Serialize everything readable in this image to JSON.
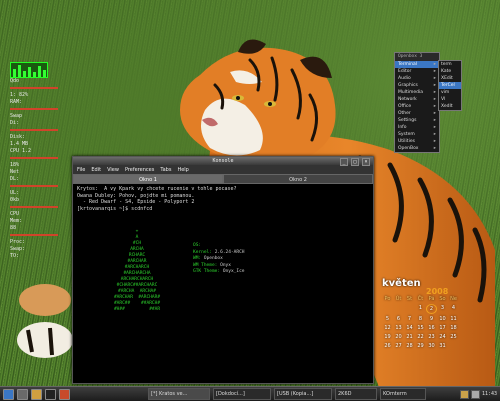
{
  "conky": {
    "lines": [
      "Qdo",
      "1: 82%",
      "RAM:",
      "",
      "Swap",
      "Di:",
      "Disk:",
      "1.4 MB",
      "CPU 1.2",
      "18%",
      "",
      "Net",
      "DL:",
      "UL:",
      "0kb",
      "CPU",
      "Mem:",
      "88",
      "Proc:",
      "Swap:",
      "TO:"
    ]
  },
  "terminal": {
    "title": "Konsole",
    "menu": [
      "File",
      "Edit",
      "View",
      "Preferences",
      "Tabs",
      "Help"
    ],
    "tabs": [
      "Okno 1",
      "Okno 2"
    ],
    "lines": [
      "Krytos:  A vy Kpark vy chcete rucenie v tohle pocase?",
      "",
      "Owana Dubley: Pohov, pojdte mi pomanou.",
      "  - Red Dwarf - S4, Epside - Polyport 2",
      "[krtovanarqis ~]$ scdnfcd"
    ],
    "logo_lines": [
      "+",
      "A",
      "#CH",
      "ARCHA",
      "RCHARC",
      "#ARCHAR",
      "#ARCHARCH",
      "#ARCHARCHA",
      "ARCHARCHARCH",
      "#CHARC##ARCHARC",
      "#ARCHA  ARCHA#",
      "#ARCHAR  #ARCHAR#",
      "#ARC##    ##ARCH#",
      "#H##         ##AR"
    ],
    "info": [
      {
        "k": "OS:",
        "v": ""
      },
      {
        "k": "Kernel:",
        "v": "2.6.24-ARCH"
      },
      {
        "k": "WM:",
        "v": "Openbox"
      },
      {
        "k": "WM Theme:",
        "v": "Onyx"
      },
      {
        "k": "GTK Theme:",
        "v": "Onyx_Ice"
      }
    ]
  },
  "menu": {
    "header": "Openbox 3",
    "items": [
      "Terminal",
      "Editor",
      "Audio",
      "Graphics",
      "Multimedia",
      "Network",
      "Office",
      "Other",
      "Settings",
      "Info",
      "System",
      "Utilities",
      "OpenBox"
    ],
    "selected": 0
  },
  "submenu": {
    "items": [
      "term",
      "Kate",
      "XEdit",
      "TerCel",
      "vim",
      "VI",
      "XedIt"
    ],
    "selected": 3
  },
  "calendar": {
    "month": "květen",
    "year": "2008",
    "headers": [
      "Po",
      "Út",
      "St",
      "Čt",
      "Pá",
      "So",
      "Ne"
    ],
    "days": [
      "",
      "",
      "",
      "1",
      "2",
      "3",
      "4",
      "5",
      "6",
      "7",
      "8",
      "9",
      "10",
      "11",
      "12",
      "13",
      "14",
      "15",
      "16",
      "17",
      "18",
      "19",
      "20",
      "21",
      "22",
      "23",
      "24",
      "25",
      "26",
      "27",
      "28",
      "29",
      "30",
      "31",
      ""
    ],
    "today": "2"
  },
  "taskbar": {
    "tasks": [
      "[*] Kratos ve...",
      "[Dokdocí...]",
      "[USB (Kopia...]",
      "2K6D",
      "KOmterm"
    ],
    "active": 0,
    "clock": "11:43"
  }
}
